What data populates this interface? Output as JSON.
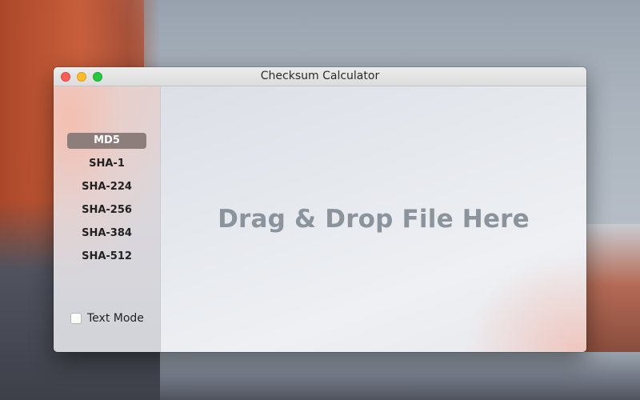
{
  "window": {
    "title": "Checksum Calculator"
  },
  "sidebar": {
    "algorithms": [
      {
        "label": "MD5",
        "selected": true
      },
      {
        "label": "SHA-1",
        "selected": false
      },
      {
        "label": "SHA-224",
        "selected": false
      },
      {
        "label": "SHA-256",
        "selected": false
      },
      {
        "label": "SHA-384",
        "selected": false
      },
      {
        "label": "SHA-512",
        "selected": false
      }
    ],
    "text_mode": {
      "label": "Text Mode",
      "checked": false
    }
  },
  "main": {
    "drop_prompt": "Drag & Drop File Here"
  },
  "colors": {
    "selected_item_bg": "#8e7e7b",
    "drop_text": "#8b939c",
    "close": "#fc5f57",
    "minimize": "#fdbc2e",
    "maximize": "#28c840"
  }
}
